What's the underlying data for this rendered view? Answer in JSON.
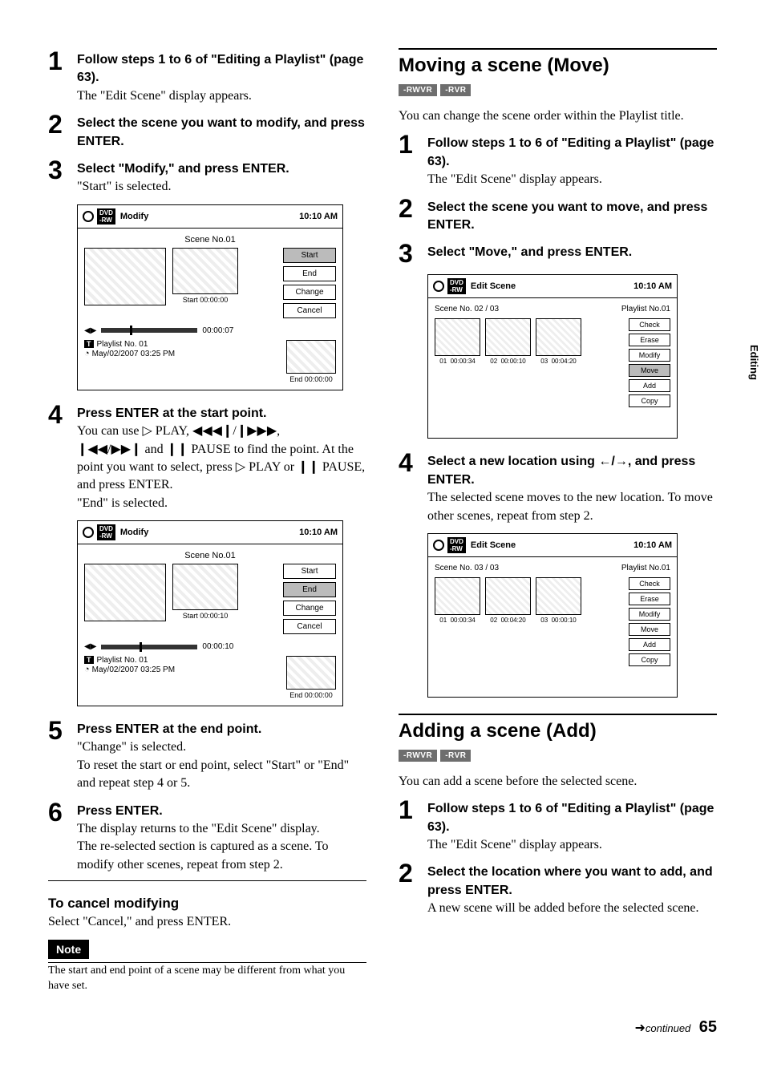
{
  "sideTab": "Editing",
  "footer": {
    "continued": "continued",
    "pageNum": "65"
  },
  "left": {
    "steps": {
      "s1": {
        "h": "Follow steps 1 to 6 of \"Editing a Playlist\" (page 63).",
        "t": "The \"Edit Scene\" display appears."
      },
      "s2": {
        "h": "Select the scene you want to modify, and press ENTER."
      },
      "s3": {
        "h": "Select \"Modify,\" and press ENTER.",
        "t": "\"Start\" is selected."
      },
      "s4": {
        "h": "Press ENTER at the start point.",
        "t1a": "You can use ",
        "t1b": " PLAY, ",
        "t2a": " and ",
        "t2b": " PAUSE to find the point. At the point you want to select, press ",
        "t2c": " PLAY or ",
        "t2d": " PAUSE, and press ENTER.",
        "t3": "\"End\" is selected."
      },
      "s5": {
        "h": "Press ENTER at the end point.",
        "t": "\"Change\" is selected.\nTo reset the start or end point, select \"Start\" or \"End\" and repeat step 4 or 5."
      },
      "s6": {
        "h": "Press ENTER.",
        "t": "The display returns to the \"Edit Scene\" display.\nThe re-selected section is captured as a scene. To modify other scenes, repeat from step 2."
      }
    },
    "cancel": {
      "h": "To cancel modifying",
      "t": "Select \"Cancel,\" and press ENTER."
    },
    "note": {
      "label": "Note",
      "t": "The start and end point of a scene may be different from what you have set."
    },
    "screen1": {
      "title": "Modify",
      "time": "10:10 AM",
      "sceneNo": "Scene No.01",
      "startLabel": "Start 00:00:00",
      "buttons": {
        "start": "Start",
        "end": "End",
        "change": "Change",
        "cancel": "Cancel"
      },
      "timeline": "00:00:07",
      "playlist": "Playlist No. 01",
      "date": "May/02/2007  03:25  PM",
      "endLabel": "End   00:00:00"
    },
    "screen2": {
      "title": "Modify",
      "time": "10:10 AM",
      "sceneNo": "Scene No.01",
      "startLabel": "Start 00:00:10",
      "buttons": {
        "start": "Start",
        "end": "End",
        "change": "Change",
        "cancel": "Cancel"
      },
      "timeline": "00:00:10",
      "playlist": "Playlist No. 01",
      "date": "May/02/2007  03:25  PM",
      "endLabel": "End   00:00:00"
    }
  },
  "right": {
    "move": {
      "title": "Moving a scene (Move)",
      "intro": "You can change the scene order within the Playlist title.",
      "badges": [
        "-RWVR",
        "-RVR"
      ],
      "s1": {
        "h": "Follow steps 1 to 6 of \"Editing a Playlist\" (page 63).",
        "t": "The \"Edit Scene\" display appears."
      },
      "s2": {
        "h": "Select the scene you want to move, and press ENTER."
      },
      "s3": {
        "h": "Select \"Move,\" and press ENTER."
      },
      "s4": {
        "h_a": "Select a new location using ",
        "h_b": ", and press ENTER.",
        "t": "The selected scene moves to the new location. To move other scenes, repeat from step 2."
      },
      "screenA": {
        "title": "Edit Scene",
        "time": "10:10 AM",
        "sceneCount": "Scene No. 02 / 03",
        "pl": "Playlist No.01",
        "thumbs": [
          {
            "n": "01",
            "t": "00:00:34"
          },
          {
            "n": "02",
            "t": "00:00:10"
          },
          {
            "n": "03",
            "t": "00:04:20"
          }
        ],
        "buttons": {
          "check": "Check",
          "erase": "Erase",
          "modify": "Modify",
          "move": "Move",
          "add": "Add",
          "copy": "Copy"
        }
      },
      "screenB": {
        "title": "Edit Scene",
        "time": "10:10 AM",
        "sceneCount": "Scene No. 03 / 03",
        "pl": "Playlist No.01",
        "thumbs": [
          {
            "n": "01",
            "t": "00:00:34"
          },
          {
            "n": "02",
            "t": "00:04:20"
          },
          {
            "n": "03",
            "t": "00:00:10"
          }
        ],
        "buttons": {
          "check": "Check",
          "erase": "Erase",
          "modify": "Modify",
          "move": "Move",
          "add": "Add",
          "copy": "Copy"
        }
      }
    },
    "add": {
      "title": "Adding a scene (Add)",
      "badges": [
        "-RWVR",
        "-RVR"
      ],
      "intro": "You can add a scene before the selected scene.",
      "s1": {
        "h": "Follow steps 1 to 6 of \"Editing a Playlist\" (page 63).",
        "t": "The \"Edit Scene\" display appears."
      },
      "s2": {
        "h": "Select the location where you want to add, and press ENTER.",
        "t": "A new scene will be added before the selected scene."
      }
    }
  }
}
